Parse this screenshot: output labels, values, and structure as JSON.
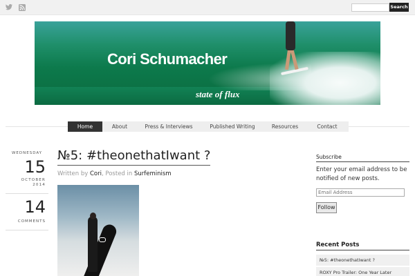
{
  "topbar": {
    "icons": [
      "twitter-icon",
      "rss-icon"
    ],
    "search_placeholder": "",
    "search_button": "Search"
  },
  "banner": {
    "title": "Cori Schumacher",
    "subtitle": "state of flux"
  },
  "nav": {
    "items": [
      {
        "label": "Home",
        "active": true
      },
      {
        "label": "About",
        "active": false
      },
      {
        "label": "Press & Interviews",
        "active": false
      },
      {
        "label": "Published Writing",
        "active": false
      },
      {
        "label": "Resources",
        "active": false
      },
      {
        "label": "Contact",
        "active": false
      }
    ]
  },
  "post": {
    "weekday": "WEDNESDAY",
    "day": "15",
    "month": "OCTOBER",
    "year": "2014",
    "comments_count": "14",
    "comments_label": "COMMENTS",
    "title": "№5: #theonethatIwant ?",
    "meta_prefix": "Written by ",
    "author": "Cori",
    "meta_middle": ", Posted in ",
    "category": "Surfeminism"
  },
  "sidebar": {
    "subscribe_heading": "Subscribe",
    "subscribe_text": "Enter your email address to be notified of new posts.",
    "email_placeholder": "Email Address",
    "follow_button": "Follow",
    "recent_heading": "Recent Posts",
    "recent_posts": [
      "№5: #theonethatIwant ?",
      "ROXY Pro Trailer: One Year Later"
    ]
  },
  "colors": {
    "nav_active_bg": "#333333",
    "nav_bg": "#eeeeee",
    "topbar_bg": "#f1f1f1",
    "banner_green": "#0d7a4c"
  }
}
